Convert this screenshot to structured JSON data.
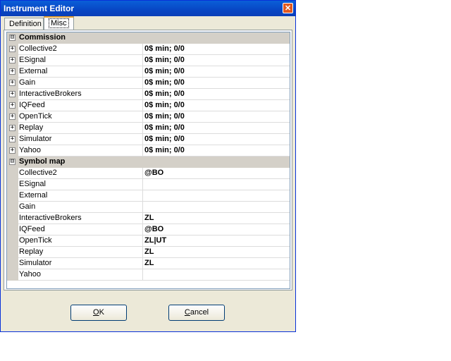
{
  "window": {
    "title": "Instrument Editor",
    "close_glyph": "✕"
  },
  "tabs": [
    {
      "label": "Definition"
    },
    {
      "label": "Misc"
    }
  ],
  "grid": {
    "collapse_glyph": "⊟",
    "expand_glyph": "+",
    "commission": {
      "label": "Commission",
      "items": [
        {
          "name": "Collective2",
          "value": "0$ min;  0/0"
        },
        {
          "name": "ESignal",
          "value": "0$ min;  0/0"
        },
        {
          "name": "External",
          "value": "0$ min;  0/0"
        },
        {
          "name": "Gain",
          "value": "0$ min;  0/0"
        },
        {
          "name": "InteractiveBrokers",
          "value": "0$ min;  0/0"
        },
        {
          "name": "IQFeed",
          "value": "0$ min;  0/0"
        },
        {
          "name": "OpenTick",
          "value": "0$ min;  0/0"
        },
        {
          "name": "Replay",
          "value": "0$ min;  0/0"
        },
        {
          "name": "Simulator",
          "value": "0$ min;  0/0"
        },
        {
          "name": "Yahoo",
          "value": "0$ min;  0/0"
        }
      ]
    },
    "symbol_map": {
      "label": "Symbol map",
      "items": [
        {
          "name": "Collective2",
          "value": "@BO"
        },
        {
          "name": "ESignal",
          "value": ""
        },
        {
          "name": "External",
          "value": ""
        },
        {
          "name": "Gain",
          "value": ""
        },
        {
          "name": "InteractiveBrokers",
          "value": "ZL"
        },
        {
          "name": "IQFeed",
          "value": "@BO"
        },
        {
          "name": "OpenTick",
          "value": "ZL|UT"
        },
        {
          "name": "Replay",
          "value": "ZL"
        },
        {
          "name": "Simulator",
          "value": "ZL"
        },
        {
          "name": "Yahoo",
          "value": ""
        }
      ]
    }
  },
  "buttons": {
    "ok": {
      "mnemonic": "O",
      "rest": "K"
    },
    "cancel": {
      "mnemonic": "C",
      "rest": "ancel"
    }
  }
}
